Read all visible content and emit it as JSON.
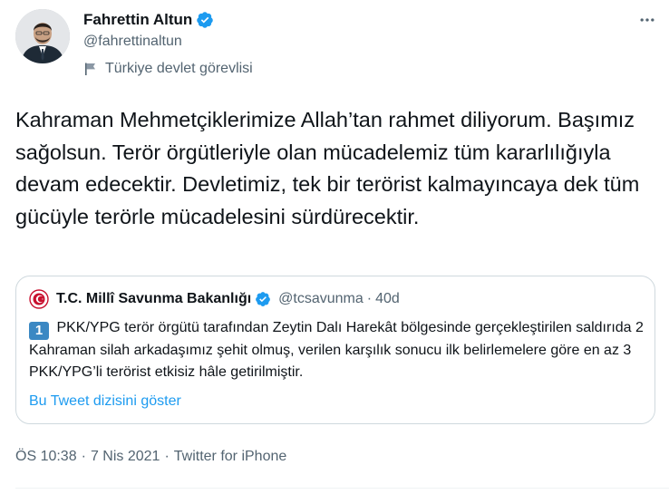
{
  "author": {
    "name": "Fahrettin Altun",
    "handle": "@fahrettinaltun",
    "label": "Türkiye devlet görevlisi",
    "verified": true
  },
  "tweet": {
    "text": "Kahraman Mehmetçiklerimize Allah’tan rahmet diliyorum. Başımız sağolsun. Terör örgütleriyle olan mücadelemiz tüm kararlılığıyla devam edecektir. Devletimiz, tek bir terörist kalmayıncaya dek tüm gücüyle terörle mücadelesini sürdürecektir.",
    "time": "ÖS 10:38",
    "date": "7 Nis 2021",
    "source": "Twitter for iPhone",
    "sep": "·"
  },
  "quote": {
    "name": "T.C. Millî Savunma Bakanlığı",
    "handle": "@tcsavunma",
    "sep": "·",
    "time": "40d",
    "number_emoji": "1",
    "text": "PKK/YPG terör örgütü tarafından Zeytin Dalı Harekât bölgesinde gerçekleştirilen saldırıda 2 Kahraman silah arkadaşımız şehit olmuş, verilen karşılık sonucu ilk belirlemelere göre en az 3 PKK/YPG’li terörist etkisiz hâle getirilmiştir.",
    "thread_link": "Bu Tweet dizisini göster"
  },
  "icons": {
    "more": "more-horizontal-icon",
    "verified": "verified-badge-icon",
    "label": "flag-icon"
  },
  "colors": {
    "text": "#0f1419",
    "secondary": "#536471",
    "link": "#1d9bf0",
    "verified": "#1d9bf0",
    "border": "#cfd9de",
    "keycap": "#3b88c3"
  }
}
